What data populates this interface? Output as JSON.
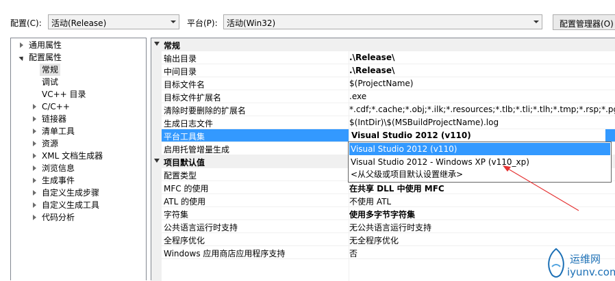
{
  "toolbar": {
    "config_label": "配置(C):",
    "config_value": "活动(Release)",
    "platform_label": "平台(P):",
    "platform_value": "活动(Win32)",
    "manager_button": "配置管理器(O)"
  },
  "tree": {
    "items": [
      {
        "label": "通用属性"
      },
      {
        "label": "配置属性"
      },
      {
        "label": "常规"
      },
      {
        "label": "调试"
      },
      {
        "label": "VC++ 目录"
      },
      {
        "label": "C/C++"
      },
      {
        "label": "链接器"
      },
      {
        "label": "清单工具"
      },
      {
        "label": "资源"
      },
      {
        "label": "XML 文档生成器"
      },
      {
        "label": "浏览信息"
      },
      {
        "label": "生成事件"
      },
      {
        "label": "自定义生成步骤"
      },
      {
        "label": "自定义生成工具"
      },
      {
        "label": "代码分析"
      }
    ]
  },
  "grid": {
    "section_general": "常规",
    "section_defaults": "项目默认值",
    "general_rows": [
      {
        "name": "输出目录",
        "value": ".\\Release\\"
      },
      {
        "name": "中间目录",
        "value": ".\\Release\\"
      },
      {
        "name": "目标文件名",
        "value": "$(ProjectName)"
      },
      {
        "name": "目标文件扩展名",
        "value": ".exe"
      },
      {
        "name": "清除时要删除的扩展名",
        "value": "*.cdf;*.cache;*.obj;*.ilk;*.resources;*.tlb;*.tli;*.tlh;*.tmp;*.rsp;*.pgc;*.pg"
      },
      {
        "name": "生成日志文件",
        "value": "$(IntDir)\\$(MSBuildProjectName).log"
      },
      {
        "name": "平台工具集",
        "value": "Visual Studio 2012 (v110)"
      },
      {
        "name": "启用托管增量生成",
        "value": ""
      }
    ],
    "default_rows": [
      {
        "name": "配置类型",
        "value": ""
      },
      {
        "name": "MFC 的使用",
        "value": "在共享 DLL 中使用 MFC"
      },
      {
        "name": "ATL 的使用",
        "value": "不使用 ATL"
      },
      {
        "name": "字符集",
        "value": "使用多字节字符集"
      },
      {
        "name": "公共语言运行时支持",
        "value": "无公共语言运行时支持"
      },
      {
        "name": "全程序优化",
        "value": "无全程序优化"
      },
      {
        "name": "Windows 应用商店应用程序支持",
        "value": "否"
      }
    ]
  },
  "dropdown": {
    "options": [
      "Visual Studio 2012 (v110)",
      "Visual Studio 2012 - Windows XP (v110_xp)",
      "<从父级或项目默认设置继承>"
    ]
  },
  "watermark": {
    "line1": "运维网",
    "line2": "iyunv.com"
  },
  "colors": {
    "selection": "#3399ff",
    "annotation_arrow": "#e53333",
    "watermark": "#1b6fb5"
  }
}
